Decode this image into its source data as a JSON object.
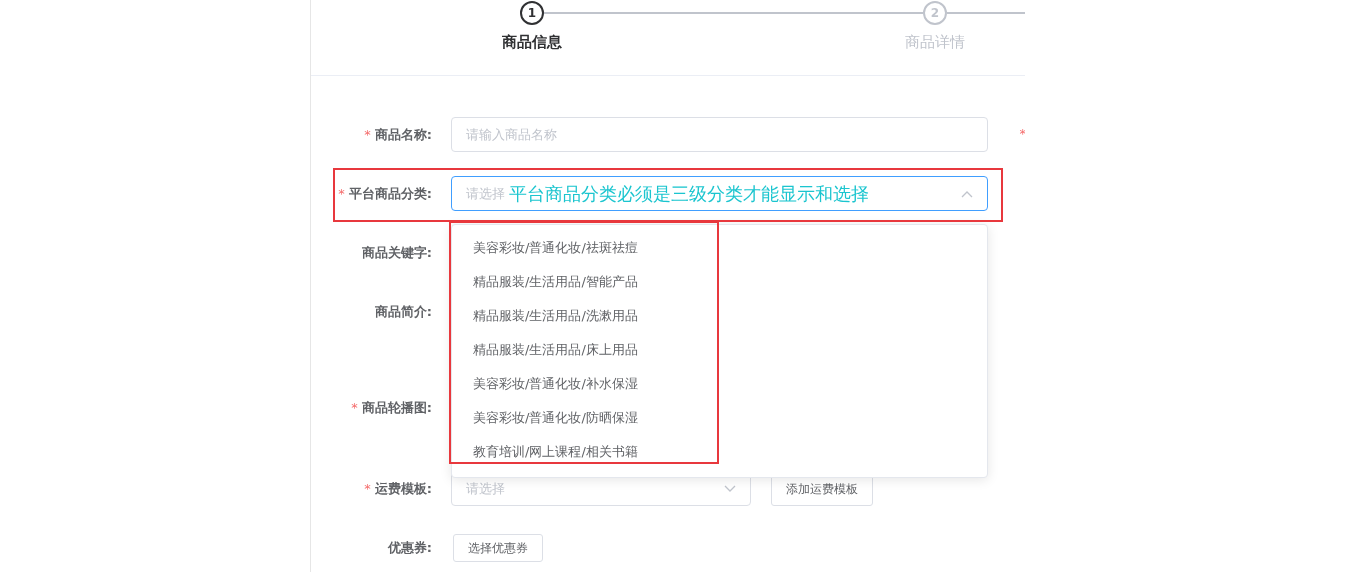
{
  "steps": [
    {
      "number": "1",
      "label": "商品信息",
      "active": true
    },
    {
      "number": "2",
      "label": "商品详情",
      "active": false
    }
  ],
  "form": {
    "fields": [
      {
        "kind": "text",
        "required_mark": "*",
        "label": "商品名称:",
        "placeholder": "请输入商品名称"
      },
      {
        "kind": "select",
        "required_mark": "*",
        "label": "平台商品分类:",
        "placeholder": "请选择",
        "focused": true,
        "annotation": "平台商品分类必须是三级分类才能显示和选择"
      },
      {
        "kind": "covered",
        "label": "商品关键字:"
      },
      {
        "kind": "covered_tall",
        "label": "商品简介:"
      },
      {
        "kind": "covered_upload",
        "required_mark": "*",
        "label": "商品轮播图:"
      },
      {
        "kind": "select_with_button",
        "required_mark": "*",
        "label": "运费模板:",
        "placeholder": "请选择",
        "focused": false,
        "button": "添加运费模板"
      },
      {
        "kind": "button_only",
        "label": "优惠券:",
        "button": "选择优惠券"
      }
    ],
    "edge_mark": "*"
  },
  "dropdown": {
    "items": [
      "美容彩妆/普通化妆/祛斑祛痘",
      "精品服装/生活用品/智能产品",
      "精品服装/生活用品/洗漱用品",
      "精品服装/生活用品/床上用品",
      "美容彩妆/普通化妆/补水保湿",
      "美容彩妆/普通化妆/防晒保湿",
      "教育培训/网上课程/相关书籍"
    ]
  }
}
